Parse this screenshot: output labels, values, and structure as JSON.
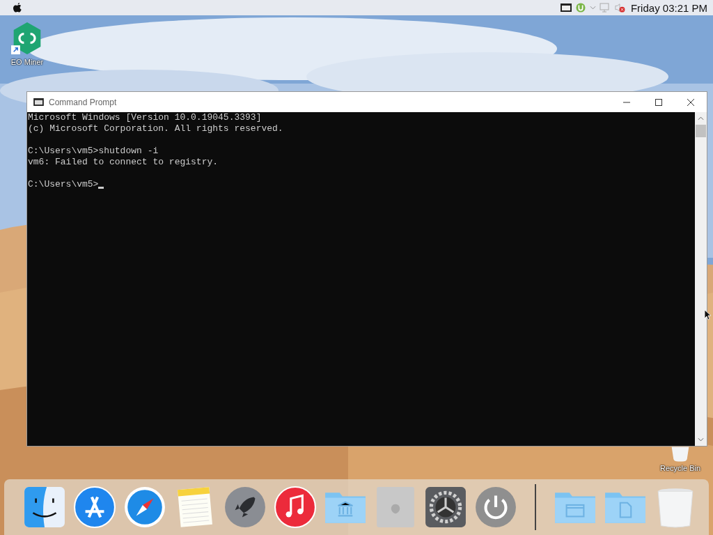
{
  "menu_bar": {
    "clock": "Friday 03:21 PM"
  },
  "desktop_icons": [
    {
      "kind": "app",
      "label": "EO Miner"
    },
    {
      "kind": "bin",
      "label": "Recycle Bin"
    }
  ],
  "window": {
    "title": "Command Prompt",
    "blocks": [
      [
        "Microsoft Windows [Version 10.0.19045.3393]",
        "(c) Microsoft Corporation. All rights reserved."
      ],
      [
        "C:\\Users\\vm5>shutdown -i",
        "vm6: Failed to connect to registry."
      ]
    ],
    "prompt": "C:\\Users\\vm5>"
  },
  "dock": {
    "items": [
      {
        "kind": "finder"
      },
      {
        "kind": "appstore"
      },
      {
        "kind": "safari"
      },
      {
        "kind": "notes"
      },
      {
        "kind": "launchpad"
      },
      {
        "kind": "music"
      },
      {
        "kind": "folder-bank"
      },
      {
        "kind": "macpro"
      },
      {
        "kind": "preferences"
      },
      {
        "kind": "power"
      },
      {
        "kind": "separator"
      },
      {
        "kind": "folder-window"
      },
      {
        "kind": "folder-doc"
      },
      {
        "kind": "trash"
      }
    ]
  }
}
